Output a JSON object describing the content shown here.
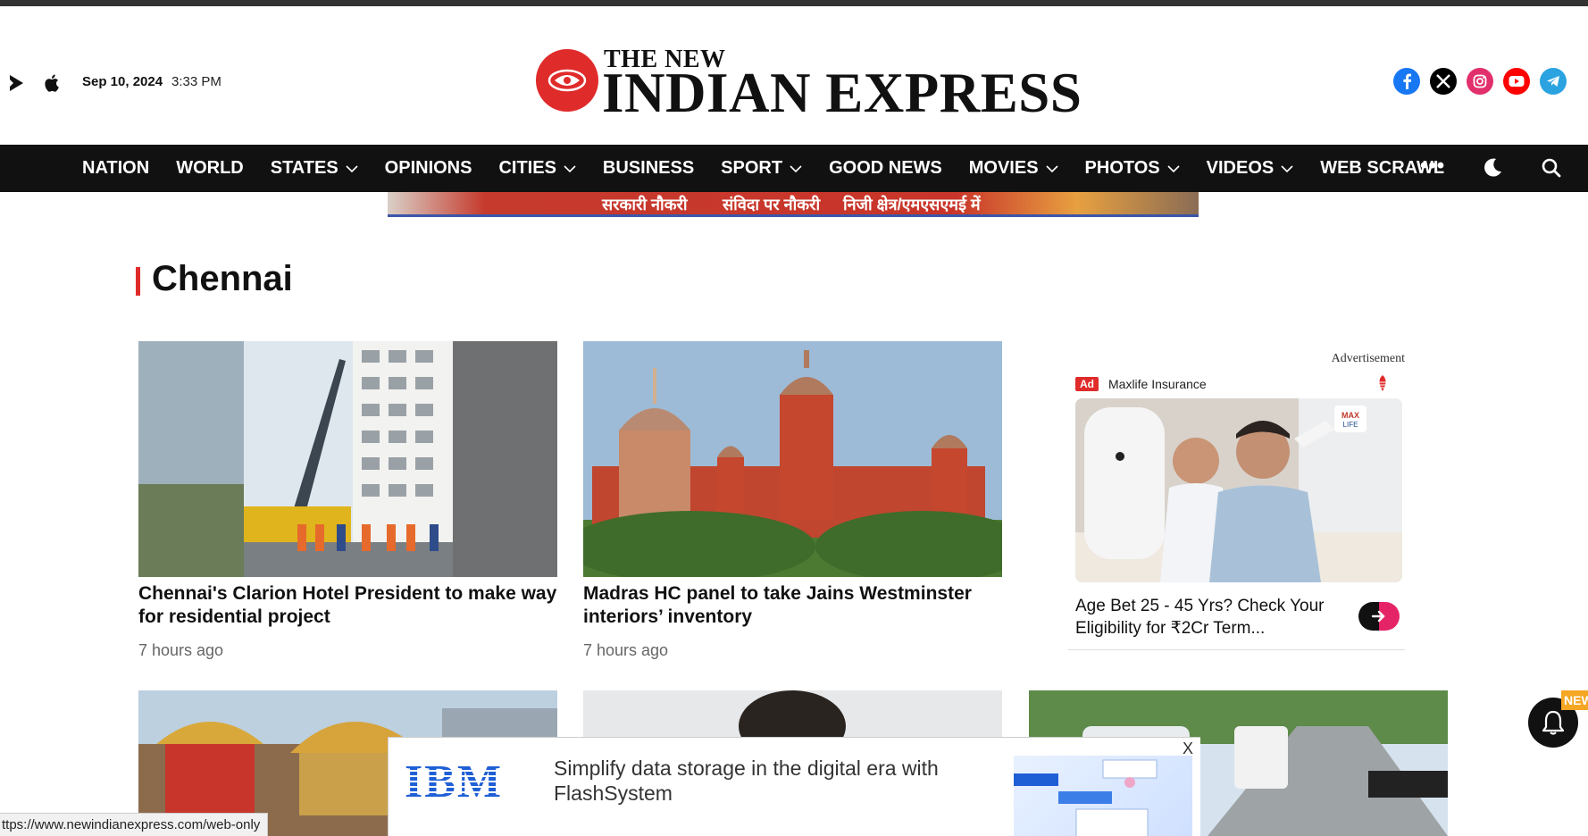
{
  "header": {
    "date": "Sep 10, 2024",
    "time": "3:33 PM",
    "logo_small": "THE NEW",
    "logo_big": "INDIAN EXPRESS",
    "store_icons": [
      "google-play-icon",
      "apple-icon"
    ],
    "social": [
      {
        "name": "facebook-icon",
        "color": "#1877f2"
      },
      {
        "name": "x-icon",
        "color": "#000000"
      },
      {
        "name": "instagram-icon",
        "color": "#e1306c"
      },
      {
        "name": "youtube-icon",
        "color": "#ff0000"
      },
      {
        "name": "telegram-icon",
        "color": "#2aa3e0"
      }
    ]
  },
  "nav": {
    "items": [
      {
        "label": "NATION",
        "dropdown": false
      },
      {
        "label": "WORLD",
        "dropdown": false
      },
      {
        "label": "STATES",
        "dropdown": true
      },
      {
        "label": "OPINIONS",
        "dropdown": false
      },
      {
        "label": "CITIES",
        "dropdown": true
      },
      {
        "label": "BUSINESS",
        "dropdown": false
      },
      {
        "label": "SPORT",
        "dropdown": true
      },
      {
        "label": "GOOD NEWS",
        "dropdown": false
      },
      {
        "label": "MOVIES",
        "dropdown": true
      },
      {
        "label": "PHOTOS",
        "dropdown": true
      },
      {
        "label": "VIDEOS",
        "dropdown": true
      },
      {
        "label": "WEB SCRAWL",
        "dropdown": false
      }
    ],
    "more": "•••"
  },
  "banner_ad": {
    "texts": [
      "सरकारी नौकरी",
      "संविदा पर नौकरी",
      "निजी क्षेत्र/एमएसएमई में"
    ]
  },
  "section": {
    "title": "Chennai"
  },
  "articles": [
    {
      "title": "Chennai's Clarion Hotel President to make way for residential project",
      "time_ago": "7 hours ago"
    },
    {
      "title": "Madras HC panel to take Jains Westminster interiors’ inventory",
      "time_ago": "7 hours ago"
    }
  ],
  "side_ad": {
    "label": "Advertisement",
    "badge": "Ad",
    "brand": "Maxlife Insurance",
    "text": "Age Bet 25 - 45 Yrs? Check Your Eligibility for ₹2Cr Term..."
  },
  "notification": {
    "new_tag": "NEW"
  },
  "bottom_ad": {
    "brand": "IBM",
    "copy": "Simplify data storage in the digital era with FlashSystem",
    "close": "X"
  },
  "status_bar": {
    "url": "ttps://www.newindianexpress.com/web-only"
  },
  "colors": {
    "accent": "#e02b2b",
    "nav_bg": "#111111",
    "new_tag": "#f5a623"
  }
}
